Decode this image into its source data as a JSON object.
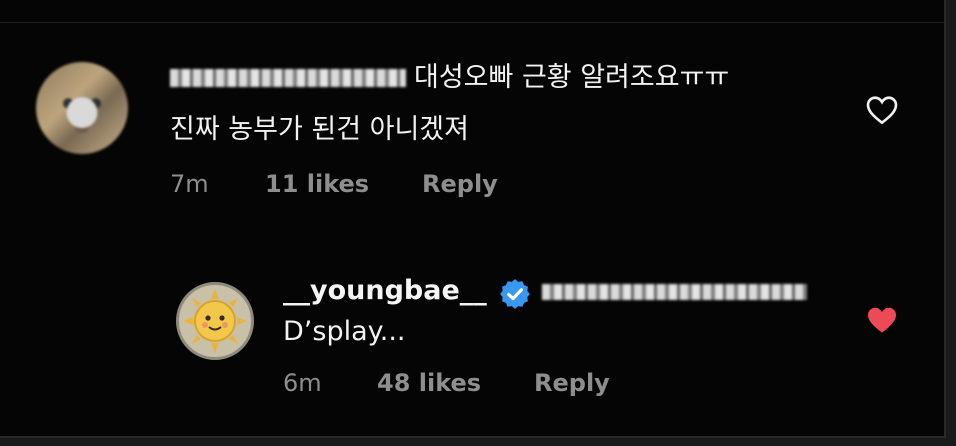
{
  "comment": {
    "avatar_icon": "pixelated-avatar-icon",
    "text_line1": "대성오빠 근황 알려조요ㅠㅠ",
    "text_line2": "진짜 농부가 된건 아니겠져",
    "time": "7m",
    "likes": "11 likes",
    "reply_label": "Reply",
    "heart_icon": "heart-outline-icon"
  },
  "reply": {
    "avatar_icon": "sun-avatar-icon",
    "username": "__youngbae__",
    "verified_icon": "verified-badge-icon",
    "text": "D’splay...",
    "time": "6m",
    "likes": "48 likes",
    "reply_label": "Reply",
    "heart_icon": "heart-filled-icon",
    "heart_color": "#ed4956",
    "verified_color": "#3897f0"
  }
}
